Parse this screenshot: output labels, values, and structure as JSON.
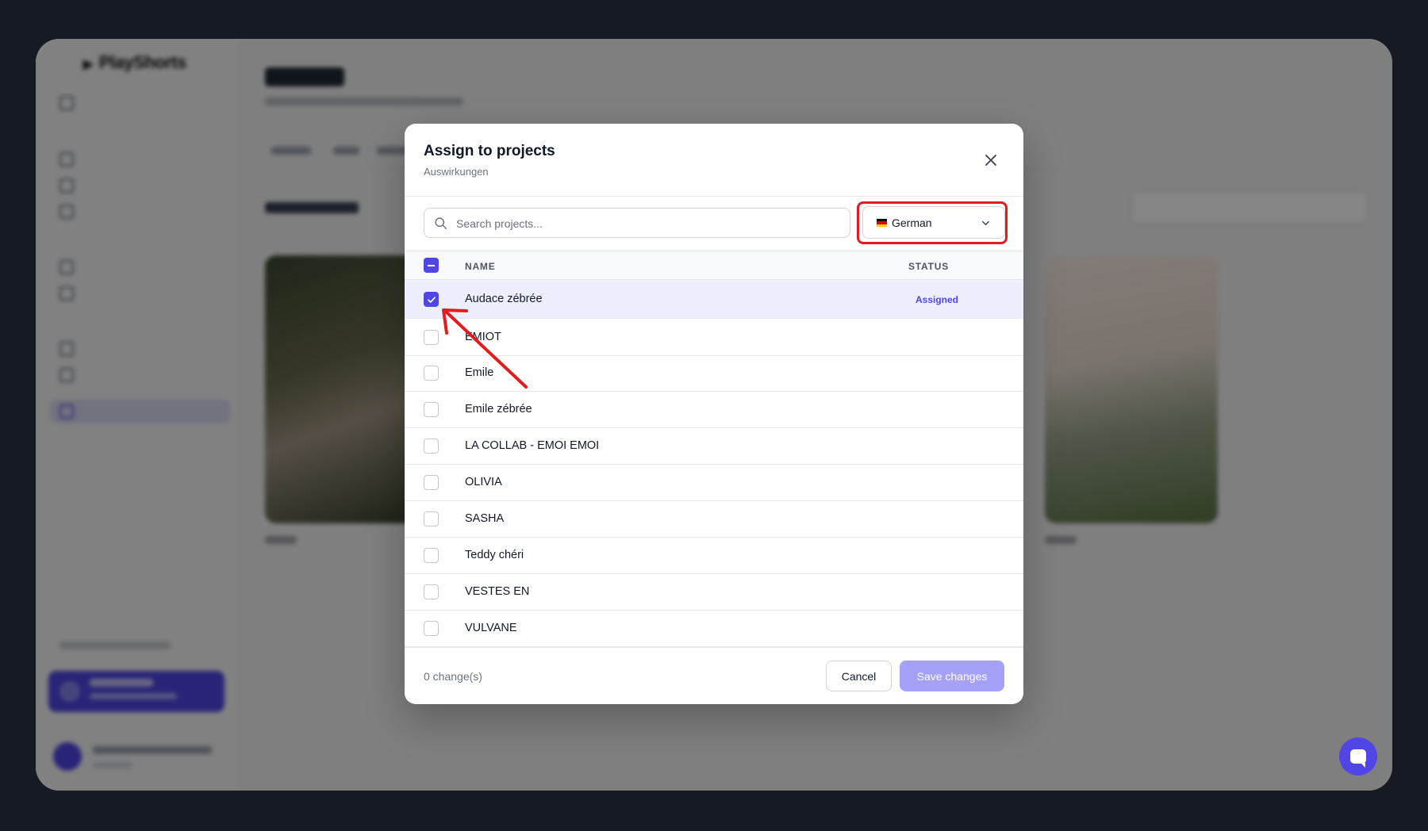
{
  "background_app": {
    "logo": "PlayShorts"
  },
  "modal": {
    "title": "Assign to projects",
    "subtitle": "Auswirkungen",
    "close_icon": "close-icon",
    "search": {
      "placeholder": "Search projects...",
      "value": "",
      "icon": "search-icon"
    },
    "language": {
      "selected": "German",
      "flag": "de-flag-icon",
      "flag_colors": [
        "#000000",
        "#dd0000",
        "#ffce00"
      ]
    },
    "table": {
      "columns": {
        "name": "NAME",
        "status": "STATUS"
      },
      "header_checkbox_state": "indeterminate",
      "rows": [
        {
          "name": "Audace zébrée",
          "checked": true,
          "status": "Assigned"
        },
        {
          "name": "EMIOT",
          "checked": false,
          "status": ""
        },
        {
          "name": "Emile",
          "checked": false,
          "status": ""
        },
        {
          "name": "Emile zébrée",
          "checked": false,
          "status": ""
        },
        {
          "name": "LA COLLAB - EMOI EMOI",
          "checked": false,
          "status": ""
        },
        {
          "name": "OLIVIA",
          "checked": false,
          "status": ""
        },
        {
          "name": "SASHA",
          "checked": false,
          "status": ""
        },
        {
          "name": "Teddy chéri",
          "checked": false,
          "status": ""
        },
        {
          "name": "VESTES EN",
          "checked": false,
          "status": ""
        },
        {
          "name": "VULVANE",
          "checked": false,
          "status": ""
        }
      ]
    },
    "footer": {
      "changes": "0 change(s)",
      "cancel_label": "Cancel",
      "save_label": "Save changes"
    }
  },
  "colors": {
    "accent": "#4f46e5",
    "save_disabled": "#a5a1f6",
    "annotation": "#e11d20"
  }
}
